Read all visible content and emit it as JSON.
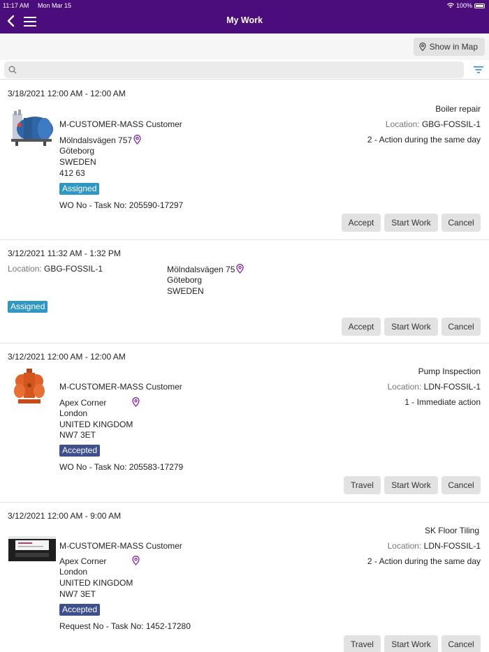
{
  "status_bar": {
    "time": "11:17 AM",
    "date": "Mon Mar 15",
    "battery": "100%"
  },
  "header": {
    "title": "My Work"
  },
  "toolbar": {
    "map_button_label": "Show in Map"
  },
  "search": {
    "placeholder": ""
  },
  "location_label": "Location:",
  "actions": {
    "accept": "Accept",
    "start_work": "Start Work",
    "cancel": "Cancel",
    "travel": "Travel"
  },
  "cards": [
    {
      "datetime": "3/18/2021 12:00 AM - 12:00 AM",
      "task": "Boiler repair",
      "customer": "M-CUSTOMER-MASS Customer",
      "location": "GBG-FOSSIL-1",
      "priority": "2 - Action during the same day",
      "address": [
        "Mölndalsvägen 757",
        "Göteborg",
        "SWEDEN",
        "412 63"
      ],
      "status": "Assigned",
      "ref": "WO No - Task No: 205590-17297"
    },
    {
      "datetime": "3/12/2021 11:32 AM - 1:32 PM",
      "location": "GBG-FOSSIL-1",
      "address": [
        "Mölndalsvägen 75",
        "Göteborg",
        "SWEDEN"
      ],
      "status": "Assigned"
    },
    {
      "datetime": "3/12/2021 12:00 AM - 12:00 AM",
      "task": "Pump Inspection",
      "customer": "M-CUSTOMER-MASS Customer",
      "location": "LDN-FOSSIL-1",
      "priority": "1 - Immediate action",
      "address": [
        "Apex Corner",
        "London",
        "UNITED KINGDOM",
        "NW7 3ET"
      ],
      "status": "Accepted",
      "ref": "WO No - Task No: 205583-17279"
    },
    {
      "datetime": "3/12/2021 12:00 AM - 9:00 AM",
      "task": "SK Floor Tiling",
      "customer": "M-CUSTOMER-MASS Customer",
      "location": "LDN-FOSSIL-1",
      "priority": "2 - Action during the same day",
      "address": [
        "Apex Corner",
        "London",
        "UNITED KINGDOM",
        "NW7 3ET"
      ],
      "status": "Accepted",
      "ref": "Request No - Task No: 1452-17280"
    }
  ],
  "colors": {
    "header": "#4b0d7c",
    "assigned": "#2f97c4",
    "accepted": "#3d4f8c",
    "pin": "#8a1fb0"
  },
  "icons": [
    "back-arrow-icon",
    "menu-icon",
    "wifi-icon",
    "battery-icon",
    "map-pin-icon",
    "search-icon",
    "filter-icon"
  ]
}
